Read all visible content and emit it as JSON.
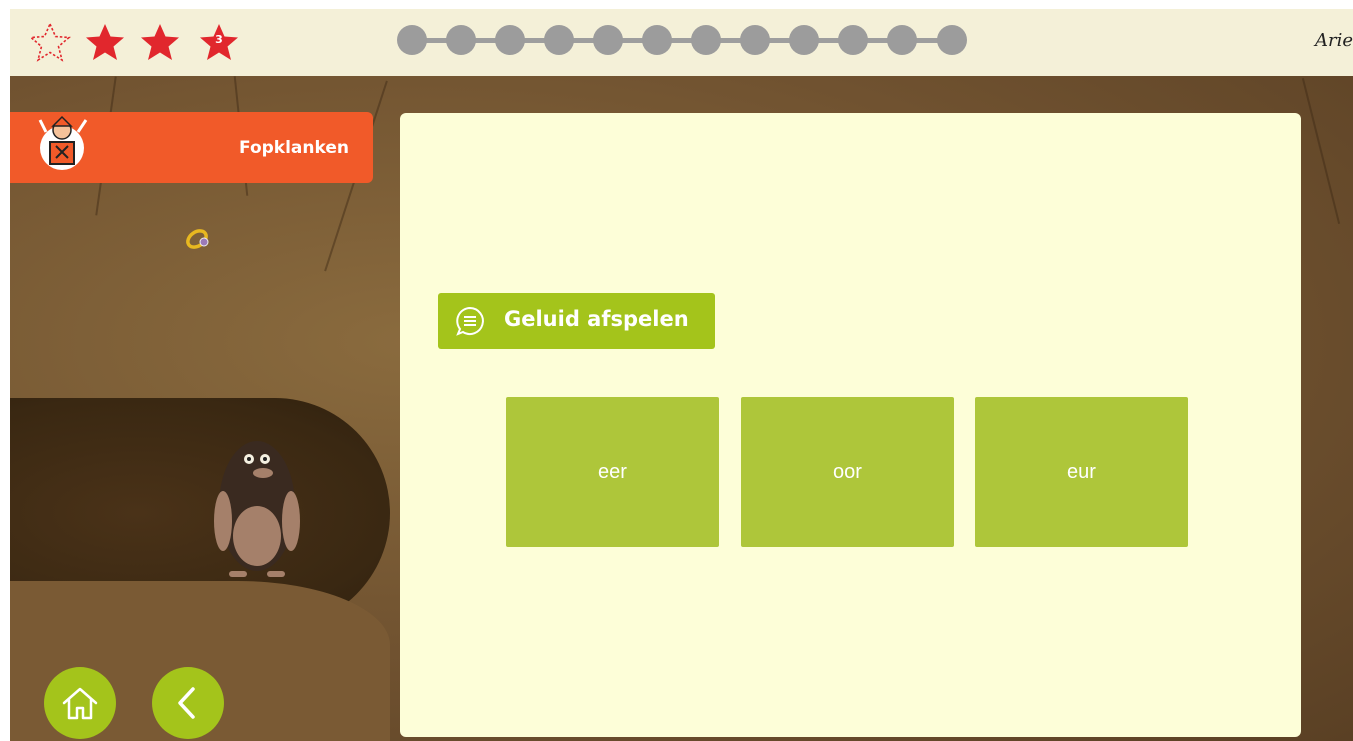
{
  "topbar": {
    "stars": [
      {
        "state": "empty",
        "icon": "star-outline-icon"
      },
      {
        "state": "filled",
        "icon": "star-icon"
      },
      {
        "state": "filled",
        "icon": "star-icon"
      },
      {
        "state": "badge",
        "icon": "star-icon",
        "count": "3"
      }
    ],
    "progress": {
      "total": 12,
      "completed": 0
    },
    "user_name": "Arie"
  },
  "header": {
    "title": "Fopklanken",
    "mascot_icon": "jack-in-the-box-mascot-icon"
  },
  "exercise": {
    "play_button_label": "Geluid afspelen",
    "play_icon": "speech-bubble-icon",
    "choices": [
      "eer",
      "oor",
      "eur"
    ]
  },
  "nav": {
    "home_icon": "home-icon",
    "back_icon": "chevron-left-icon"
  },
  "colors": {
    "accent_green": "#a4c41b",
    "header_orange": "#f15a29",
    "panel_bg": "#fdfed8",
    "star_red": "#e1272d"
  }
}
